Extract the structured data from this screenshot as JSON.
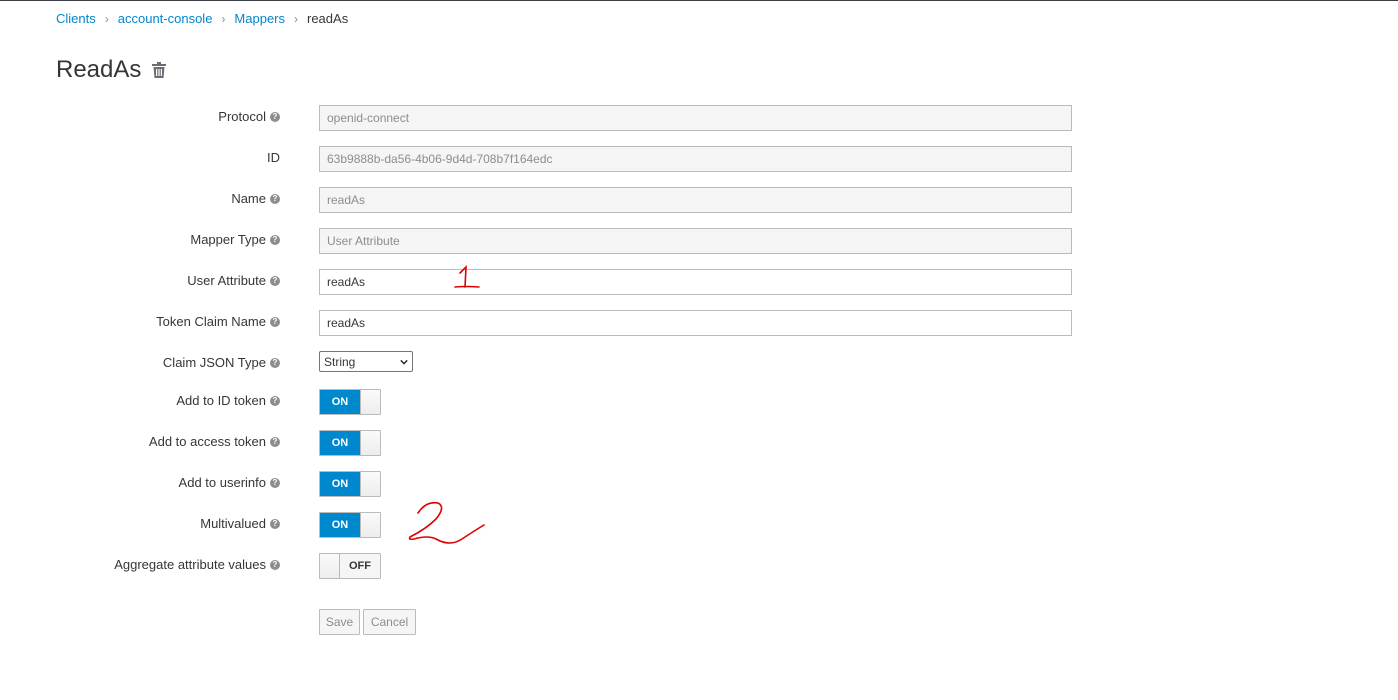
{
  "breadcrumb": {
    "items": [
      "Clients",
      "account-console",
      "Mappers"
    ],
    "current": "readAs",
    "separator": "›"
  },
  "page": {
    "title": "ReadAs"
  },
  "form": {
    "protocol": {
      "label": "Protocol",
      "value": "openid-connect"
    },
    "id": {
      "label": "ID",
      "value": "63b9888b-da56-4b06-9d4d-708b7f164edc"
    },
    "name": {
      "label": "Name",
      "value": "readAs"
    },
    "mapper_type": {
      "label": "Mapper Type",
      "value": "User Attribute"
    },
    "user_attribute": {
      "label": "User Attribute",
      "value": "readAs"
    },
    "token_claim_name": {
      "label": "Token Claim Name",
      "value": "readAs"
    },
    "claim_json_type": {
      "label": "Claim JSON Type",
      "value": "String"
    },
    "add_to_id_token": {
      "label": "Add to ID token",
      "state": "ON"
    },
    "add_to_access_token": {
      "label": "Add to access token",
      "state": "ON"
    },
    "add_to_userinfo": {
      "label": "Add to userinfo",
      "state": "ON"
    },
    "multivalued": {
      "label": "Multivalued",
      "state": "ON"
    },
    "aggregate_attribute_values": {
      "label": "Aggregate attribute values",
      "state": "OFF"
    }
  },
  "buttons": {
    "save": "Save",
    "cancel": "Cancel"
  },
  "help_glyph": "?",
  "annotations": {
    "first": "1",
    "second": "2",
    "color": "#e00000"
  },
  "colors": {
    "link": "#0088ce",
    "toggle_on": "#0088ce",
    "readonly_bg": "#f5f5f5"
  }
}
